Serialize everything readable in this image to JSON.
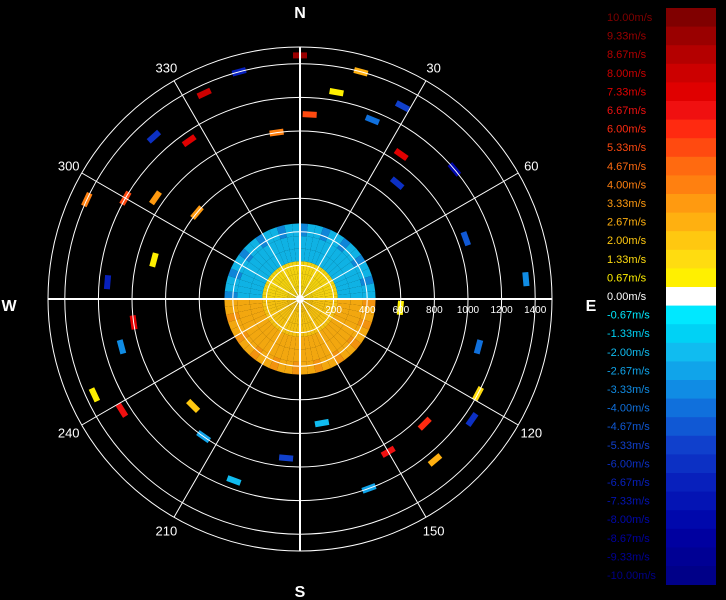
{
  "chart_data": {
    "type": "polar-heatmap",
    "title": "",
    "compass": {
      "north": "N",
      "east": "E",
      "south": "S",
      "west": "W"
    },
    "azimuth_ticks": [
      "30",
      "60",
      "120",
      "150",
      "210",
      "240",
      "300",
      "330"
    ],
    "range_ticks": [
      "200",
      "400",
      "600",
      "800",
      "1000",
      "1200",
      "1400"
    ],
    "range_max": 1500,
    "grid": true,
    "colorbar": {
      "position": "right",
      "entries": [
        {
          "label": "10.00m/s",
          "value": 10.0,
          "color": "#800000"
        },
        {
          "label": "9.33m/s",
          "value": 9.33,
          "color": "#9a0000"
        },
        {
          "label": "8.67m/s",
          "value": 8.67,
          "color": "#b40000"
        },
        {
          "label": "8.00m/s",
          "value": 8.0,
          "color": "#cc0000"
        },
        {
          "label": "7.33m/s",
          "value": 7.33,
          "color": "#e00000"
        },
        {
          "label": "6.67m/s",
          "value": 6.67,
          "color": "#f01010"
        },
        {
          "label": "6.00m/s",
          "value": 6.0,
          "color": "#ff2a10"
        },
        {
          "label": "5.33m/s",
          "value": 5.33,
          "color": "#ff4a10"
        },
        {
          "label": "4.67m/s",
          "value": 4.67,
          "color": "#ff6a10"
        },
        {
          "label": "4.00m/s",
          "value": 4.0,
          "color": "#ff8010"
        },
        {
          "label": "3.33m/s",
          "value": 3.33,
          "color": "#ff9a10"
        },
        {
          "label": "2.67m/s",
          "value": 2.67,
          "color": "#ffb010"
        },
        {
          "label": "2.00m/s",
          "value": 2.0,
          "color": "#ffc810"
        },
        {
          "label": "1.33m/s",
          "value": 1.33,
          "color": "#ffdc10"
        },
        {
          "label": "0.67m/s",
          "value": 0.67,
          "color": "#fff000"
        },
        {
          "label": "0.00m/s",
          "value": 0.0,
          "color": "#ffffff"
        },
        {
          "label": "-0.67m/s",
          "value": -0.67,
          "color": "#00e8ff"
        },
        {
          "label": "-1.33m/s",
          "value": -1.33,
          "color": "#00d2f5"
        },
        {
          "label": "-2.00m/s",
          "value": -2.0,
          "color": "#10bcf0"
        },
        {
          "label": "-2.67m/s",
          "value": -2.67,
          "color": "#10a4ea"
        },
        {
          "label": "-3.33m/s",
          "value": -3.33,
          "color": "#108ce4"
        },
        {
          "label": "-4.00m/s",
          "value": -4.0,
          "color": "#1070dc"
        },
        {
          "label": "-4.67m/s",
          "value": -4.67,
          "color": "#1058d4"
        },
        {
          "label": "-5.33m/s",
          "value": -5.33,
          "color": "#1040cc"
        },
        {
          "label": "-6.00m/s",
          "value": -6.0,
          "color": "#0c30c4"
        },
        {
          "label": "-6.67m/s",
          "value": -6.67,
          "color": "#0820bc"
        },
        {
          "label": "-7.33m/s",
          "value": -7.33,
          "color": "#0414b4"
        },
        {
          "label": "-8.00m/s",
          "value": -8.0,
          "color": "#0008ac"
        },
        {
          "label": "-8.67m/s",
          "value": -8.67,
          "color": "#0000a0"
        },
        {
          "label": "-9.33m/s",
          "value": -9.33,
          "color": "#000094"
        },
        {
          "label": "-10.00m/s",
          "value": -10.0,
          "color": "#000088"
        }
      ]
    },
    "cells": [
      {
        "az": 0,
        "r": 1450,
        "v": 9.3
      },
      {
        "az": 15,
        "r": 1400,
        "v": 2.7
      },
      {
        "az": 10,
        "r": 1250,
        "v": 0.7
      },
      {
        "az": 3,
        "r": 1100,
        "v": 5.3
      },
      {
        "az": 22,
        "r": 1150,
        "v": -4.0
      },
      {
        "az": 28,
        "r": 1300,
        "v": -5.3
      },
      {
        "az": 35,
        "r": 1050,
        "v": 7.3
      },
      {
        "az": 40,
        "r": 900,
        "v": -6.0
      },
      {
        "az": 50,
        "r": 1200,
        "v": -8.0
      },
      {
        "az": 70,
        "r": 1050,
        "v": -4.7
      },
      {
        "az": 85,
        "r": 1350,
        "v": -3.3
      },
      {
        "az": 95,
        "r": 600,
        "v": 0.7
      },
      {
        "az": 105,
        "r": 1100,
        "v": -4.0
      },
      {
        "az": 118,
        "r": 1200,
        "v": 1.3
      },
      {
        "az": 125,
        "r": 1250,
        "v": -6.0
      },
      {
        "az": 135,
        "r": 1050,
        "v": 6.0
      },
      {
        "az": 140,
        "r": 1250,
        "v": 2.7
      },
      {
        "az": 150,
        "r": 1050,
        "v": 6.7
      },
      {
        "az": 160,
        "r": 1200,
        "v": -2.7
      },
      {
        "az": 170,
        "r": 750,
        "v": -2.0
      },
      {
        "az": 185,
        "r": 950,
        "v": -5.3
      },
      {
        "az": 200,
        "r": 1150,
        "v": -2.0
      },
      {
        "az": 215,
        "r": 1000,
        "v": -2.7
      },
      {
        "az": 225,
        "r": 900,
        "v": 2.0
      },
      {
        "az": 238,
        "r": 1250,
        "v": 6.7
      },
      {
        "az": 245,
        "r": 1350,
        "v": 0.7
      },
      {
        "az": 255,
        "r": 1100,
        "v": -3.3
      },
      {
        "az": 262,
        "r": 1000,
        "v": 7.3
      },
      {
        "az": 275,
        "r": 1150,
        "v": -6.7
      },
      {
        "az": 285,
        "r": 900,
        "v": 0.7
      },
      {
        "az": 295,
        "r": 1400,
        "v": 4.0
      },
      {
        "az": 300,
        "r": 1200,
        "v": 5.3
      },
      {
        "az": 305,
        "r": 1050,
        "v": 3.3
      },
      {
        "az": 310,
        "r": 800,
        "v": 3.3
      },
      {
        "az": 318,
        "r": 1300,
        "v": -6.0
      },
      {
        "az": 325,
        "r": 1150,
        "v": 7.3
      },
      {
        "az": 335,
        "r": 1350,
        "v": 8.0
      },
      {
        "az": 345,
        "r": 1400,
        "v": -6.7
      },
      {
        "az": 352,
        "r": 1000,
        "v": 4.0
      }
    ],
    "core": {
      "max_range": 450,
      "north_side": "positive",
      "south_side": "negative"
    }
  }
}
